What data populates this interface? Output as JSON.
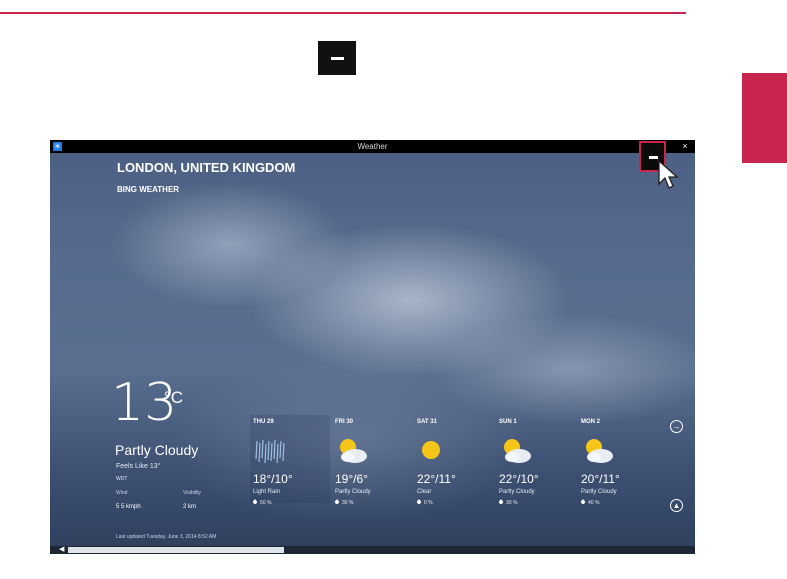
{
  "window": {
    "title": "Weather",
    "close_glyph": "×",
    "app_icon": "☀"
  },
  "location": {
    "city": "LONDON, UNITED KINGDOM",
    "provider": "BING WEATHER"
  },
  "current": {
    "temp": "13",
    "unit": "°C",
    "condition": "Partly Cloudy",
    "feels_like": "Feels Like 13°",
    "source": "WDT",
    "wind_label": "Wind",
    "wind_value": "5 5 kmph",
    "visibility_label": "Visibility",
    "visibility_value": "2 km",
    "updated": "Last updated Tuesday, June 3, 2014 8:52 AM"
  },
  "forecast": [
    {
      "day": "THU 29",
      "hilo": "18°/10°",
      "desc": "Light Rain",
      "precip": "50 %",
      "icon": "rain-icon"
    },
    {
      "day": "FRI 30",
      "hilo": "19°/6°",
      "desc": "Partly Cloudy",
      "precip": "30 %",
      "icon": "partly-cloudy-icon"
    },
    {
      "day": "SAT 31",
      "hilo": "22°/11°",
      "desc": "Clear",
      "precip": "0 %",
      "icon": "sun-icon"
    },
    {
      "day": "SUN 1",
      "hilo": "22°/10°",
      "desc": "Partly Cloudy",
      "precip": "30 %",
      "icon": "partly-cloudy-icon"
    },
    {
      "day": "MON 2",
      "hilo": "20°/11°",
      "desc": "Partly Cloudy",
      "precip": "40 %",
      "icon": "partly-cloudy-icon"
    }
  ],
  "nav": {
    "next_glyph": "→",
    "up_glyph": "▲",
    "scroll_left_glyph": "◀"
  },
  "colors": {
    "accent": "#c8264f",
    "titlebar": "#000000",
    "app_icon": "#1e78e6"
  }
}
